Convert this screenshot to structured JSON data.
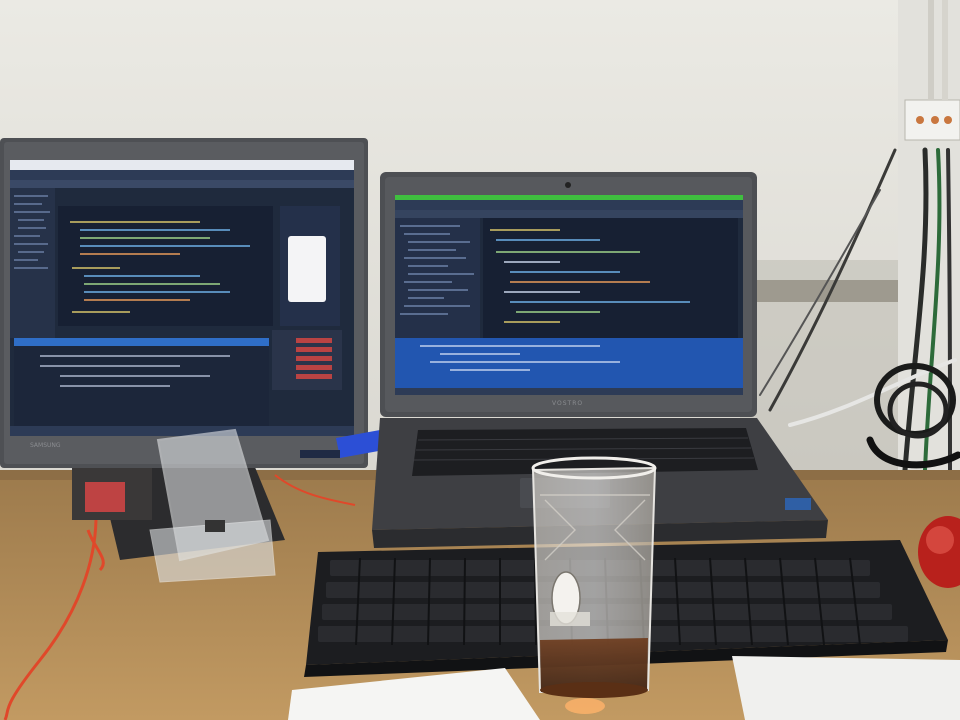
{
  "scene": {
    "description_free": true,
    "brands": {
      "monitor_bezel": "SAMSUNG",
      "laptop_lid": "VOSTRO"
    },
    "colors": {
      "wall": "#ebeae4",
      "desk": "#b08a56",
      "ide_background": "#1f2a3d",
      "ide_menu": "#2d3b56",
      "ide_accent_green": "#3fbf3f",
      "keyboard": "#1c1d20",
      "cable_red": "#e0482a",
      "usb_blue": "#2c4fd6",
      "mouse_red": "#b8211c"
    },
    "icons": [
      "drinking-glass",
      "usb-stick",
      "computer-mouse",
      "smartphone-on-screen"
    ]
  }
}
